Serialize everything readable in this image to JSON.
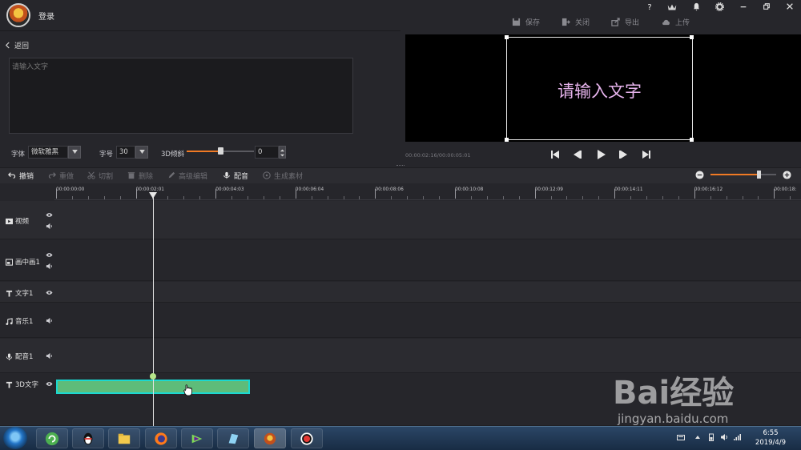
{
  "titlebar": {
    "login": "登录",
    "actions": {
      "save": "保存",
      "close": "关闭",
      "export": "导出",
      "upload": "上传"
    },
    "icons": [
      "help-icon",
      "vip-icon",
      "bell-icon",
      "gear-icon",
      "minimize-icon",
      "restore-icon",
      "close-icon"
    ],
    "help_glyph": "?"
  },
  "editor": {
    "back": "返回",
    "text_placeholder": "请输入文字",
    "font_label": "字体",
    "font_value": "微软雅黑",
    "size_label": "字号",
    "size_value": "30",
    "tilt_label": "3D倾斜",
    "tilt_value": "0",
    "tilt_level": 0.5
  },
  "preview": {
    "text": "请输入文字",
    "text_color": "#e6b3ec",
    "timecode": "00:00:02:16/00:00:05:01"
  },
  "toolbar": {
    "undo": "撤销",
    "redo": "重做",
    "cut": "切割",
    "delete": "删除",
    "advanced": "高级编辑",
    "dub": "配音",
    "generate": "生成素材",
    "zoom_level": 0.73
  },
  "ruler": {
    "ticks": [
      "00:00:00:00",
      "00:00:02:01",
      "00:00:04:03",
      "00:00:06:04",
      "00:00:08:06",
      "00:00:10:08",
      "00:00:12:09",
      "00:00:14:11",
      "00:00:16:12",
      "00:00:18:"
    ]
  },
  "tracks": [
    {
      "name": "视频",
      "icon": "video-icon"
    },
    {
      "name": "画中画1",
      "icon": "pip-icon"
    },
    {
      "name": "文字1",
      "icon": "text-icon"
    },
    {
      "name": "音乐1",
      "icon": "music-icon"
    },
    {
      "name": "配音1",
      "icon": "mic-icon"
    },
    {
      "name": "3D文字",
      "icon": "text-icon"
    }
  ],
  "taskbar": {
    "time": "6:55",
    "date": "2019/4/9"
  },
  "watermark": {
    "brand": "Bai经验",
    "url": "jingyan.baidu.com"
  },
  "colors": {
    "accent": "#f07a24",
    "clip": "#5ebc7a",
    "clip_border": "#1bd8d0"
  }
}
